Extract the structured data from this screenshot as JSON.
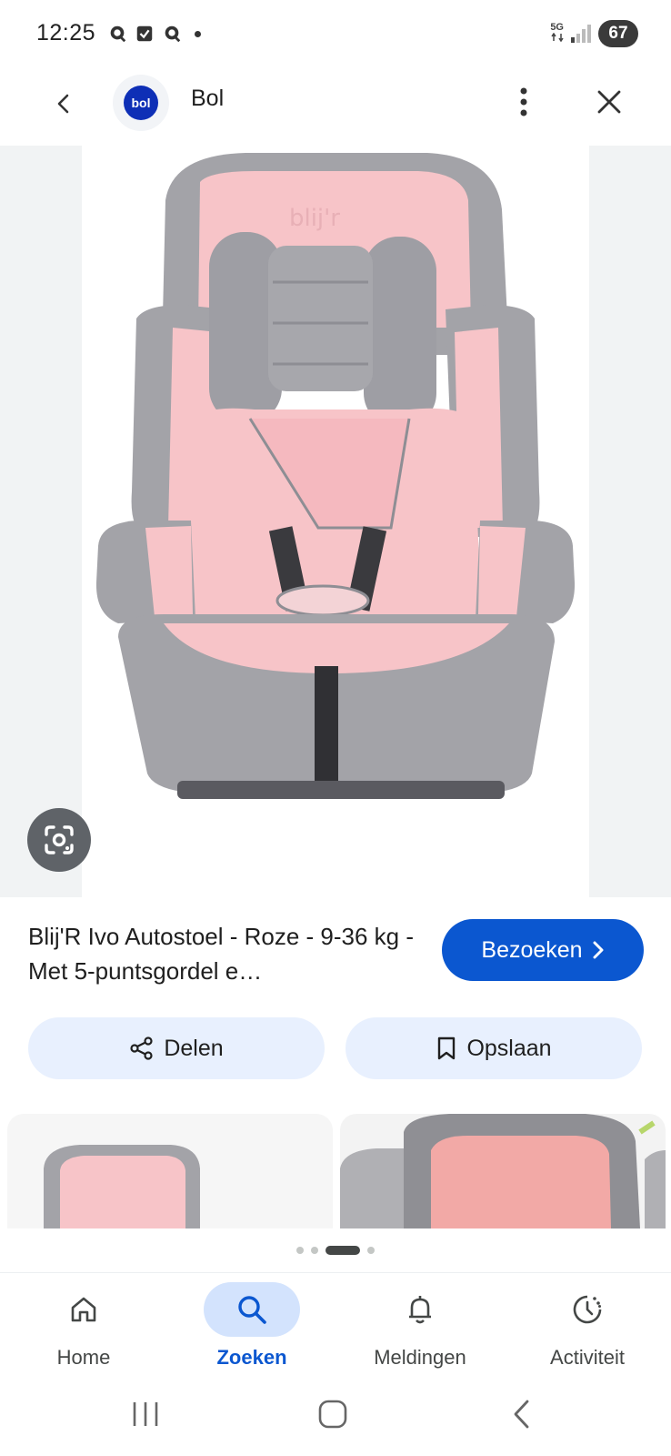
{
  "status_bar": {
    "time": "12:25",
    "network": "5G",
    "battery": "67"
  },
  "header": {
    "site_logo_text": "bol",
    "site_name": "Bol",
    "back_icon": "chevron-left-icon",
    "more_icon": "more-vert-icon",
    "close_icon": "close-icon"
  },
  "image": {
    "lens_icon": "google-lens-icon",
    "brand_mark": "blij'r"
  },
  "product": {
    "title": "Blij'R Ivo Autostoel - Roze - 9-36 kg - Met 5-puntsgordel e…",
    "visit_label": "Bezoeken"
  },
  "actions": {
    "share_label": "Delen",
    "save_label": "Opslaan"
  },
  "bottom_nav": {
    "items": [
      {
        "label": "Home",
        "icon": "home-icon"
      },
      {
        "label": "Zoeken",
        "icon": "search-icon"
      },
      {
        "label": "Meldingen",
        "icon": "bell-icon"
      },
      {
        "label": "Activiteit",
        "icon": "activity-icon"
      }
    ],
    "active_index": 1
  },
  "colors": {
    "accent": "#0b57d0",
    "action_bg": "#e8f0fe",
    "seat_pink": "#f7c4c8",
    "seat_grey": "#a3a3a8"
  }
}
